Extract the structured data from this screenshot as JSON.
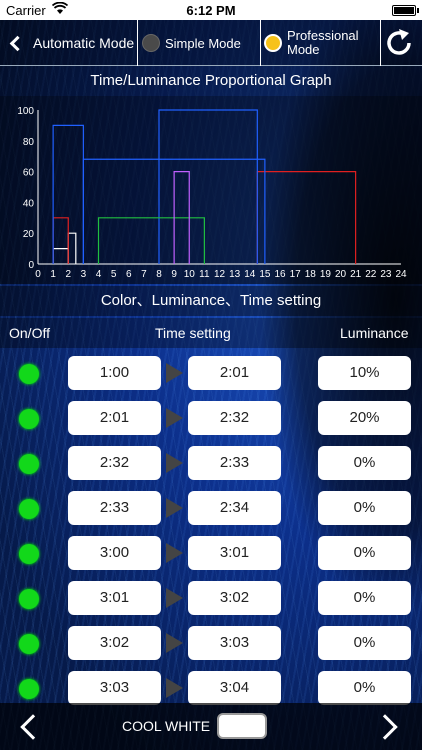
{
  "status_bar": {
    "carrier": "Carrier",
    "time": "6:12 PM"
  },
  "mode_bar": {
    "back_label": "Automatic Mode",
    "simple_label": "Simple Mode",
    "professional_label": "Professional Mode",
    "selected": "professional"
  },
  "graph_section": {
    "title": "Time/Luminance Proportional Graph"
  },
  "chart_data": {
    "type": "line",
    "title": "",
    "xlim": [
      0,
      24
    ],
    "ylim": [
      0,
      100
    ],
    "x_ticks": [
      "0",
      "1",
      "2",
      "3",
      "4",
      "5",
      "6",
      "7",
      "8",
      "9",
      "10",
      "11",
      "12",
      "13",
      "14",
      "15",
      "16",
      "17",
      "18",
      "19",
      "20",
      "21",
      "22",
      "23",
      "24"
    ],
    "y_ticks": [
      "0",
      "20",
      "40",
      "60",
      "80",
      "100"
    ],
    "grid": false,
    "series": [
      {
        "color": "#ffffff",
        "intervals": [
          {
            "start": 1.0,
            "end": 2.0,
            "value": 10
          },
          {
            "start": 2.0,
            "end": 2.5,
            "value": 20
          }
        ]
      },
      {
        "color": "#e02020",
        "intervals": [
          {
            "start": 1.0,
            "end": 2.0,
            "value": 30
          },
          {
            "start": 14.5,
            "end": 21.0,
            "value": 60
          }
        ]
      },
      {
        "color": "#2060ff",
        "intervals": [
          {
            "start": 1.0,
            "end": 3.0,
            "value": 90
          },
          {
            "start": 3.0,
            "end": 15.0,
            "value": 68
          },
          {
            "start": 8.0,
            "end": 14.5,
            "value": 100
          }
        ]
      },
      {
        "color": "#20c040",
        "intervals": [
          {
            "start": 4.0,
            "end": 11.0,
            "value": 30
          }
        ]
      },
      {
        "color": "#c060ff",
        "intervals": [
          {
            "start": 9.0,
            "end": 10.0,
            "value": 60
          }
        ]
      }
    ]
  },
  "setting_section": {
    "title": "Color、Luminance、Time setting"
  },
  "columns": {
    "onoff": "On/Off",
    "time": "Time setting",
    "luminance": "Luminance"
  },
  "rows": [
    {
      "start": "1:00",
      "end": "2:01",
      "luminance": "10%"
    },
    {
      "start": "2:01",
      "end": "2:32",
      "luminance": "20%"
    },
    {
      "start": "2:32",
      "end": "2:33",
      "luminance": "0%"
    },
    {
      "start": "2:33",
      "end": "2:34",
      "luminance": "0%"
    },
    {
      "start": "3:00",
      "end": "3:01",
      "luminance": "0%"
    },
    {
      "start": "3:01",
      "end": "3:02",
      "luminance": "0%"
    },
    {
      "start": "3:02",
      "end": "3:03",
      "luminance": "0%"
    },
    {
      "start": "3:03",
      "end": "3:04",
      "luminance": "0%"
    }
  ],
  "bottom_bar": {
    "color_name": "COOL WHITE",
    "swatch_color": "#ffffff"
  },
  "colors": {
    "led_on": "#12d81a",
    "selected_radio": "#f7c21a"
  }
}
